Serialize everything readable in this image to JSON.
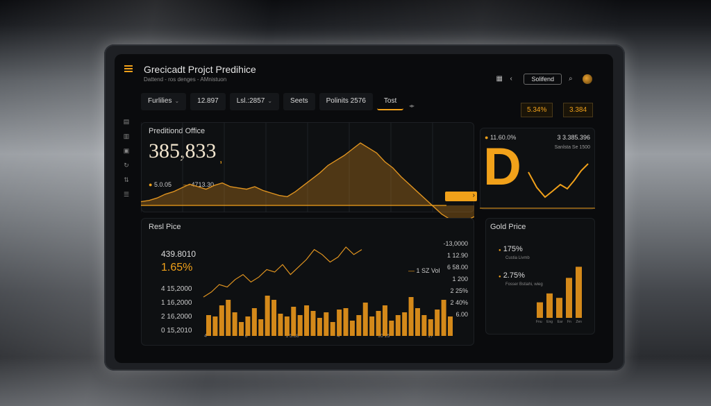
{
  "app": {
    "title": "Grecicadt Projct Predihice",
    "subtitle": "Dattend  -  ros denges  -  AMnistuon"
  },
  "top_right": {
    "button_label": "Solifend"
  },
  "tabs": [
    {
      "label": "Furlilies"
    },
    {
      "label": "12.897"
    },
    {
      "label": "Lsl.:2857"
    },
    {
      "label": "Seets"
    },
    {
      "label": "Polinits 2576"
    },
    {
      "label": "Tost"
    }
  ],
  "pills": {
    "left": "5.34%",
    "right": "3.384"
  },
  "main_chart": {
    "title": "Preditiond Office",
    "value": "385,833",
    "legend_a": "5.0.05",
    "legend_b": "4713.30",
    "right_badge": "11.60.0%",
    "right_value": "3 3.385.396",
    "right_caption": "Sanlsta Se 1500",
    "big_letter": "D",
    "series": [
      6,
      8,
      12,
      18,
      22,
      28,
      34,
      30,
      26,
      32,
      36,
      30,
      28,
      26,
      30,
      24,
      20,
      16,
      14,
      22,
      32,
      42,
      52,
      64,
      72,
      80,
      90,
      100,
      92,
      84,
      70,
      60,
      46,
      34,
      22,
      10,
      -2,
      -14,
      -22,
      -30,
      -24,
      -18
    ]
  },
  "real_price": {
    "title": "Resl Pice",
    "stat_1": "439.8010",
    "stat_2": "1.65%",
    "tick_labels": [
      "4 15,2000",
      "1 16,2000",
      "2 16,2000",
      "0 15,2010"
    ],
    "right_labels": [
      "-13,0000",
      "1 12.90",
      "6 58.00",
      "1 200",
      "2 25%",
      "2 40%",
      "6.00"
    ],
    "legend_label": "1 SZ Vol",
    "x_ticks": [
      "4",
      "6",
      "1 5.88",
      "4",
      "10 15",
      "17"
    ],
    "line": [
      20,
      24,
      30,
      28,
      34,
      38,
      32,
      36,
      42,
      40,
      46,
      38,
      44,
      50,
      58,
      54,
      48,
      52,
      60,
      54,
      58
    ],
    "bars": [
      30,
      28,
      44,
      52,
      34,
      20,
      28,
      40,
      24,
      58,
      52,
      32,
      28,
      42,
      30,
      44,
      36,
      26,
      34,
      20,
      38,
      40,
      22,
      30,
      48,
      28,
      36,
      44,
      22,
      30,
      34,
      56,
      40,
      30,
      24,
      38,
      52,
      28
    ]
  },
  "gold_price": {
    "title": "Gold Price",
    "stat_1": "175%",
    "stat_1_caption": "Custia Livmb",
    "stat_2": "2.75%",
    "stat_2_caption": "Fosser  Bstiahi, wieg",
    "bars": [
      14,
      22,
      18,
      36,
      46
    ],
    "x_ticks": [
      "Fnu",
      "Eng",
      "Ear",
      "Fn",
      "Zen"
    ]
  }
}
